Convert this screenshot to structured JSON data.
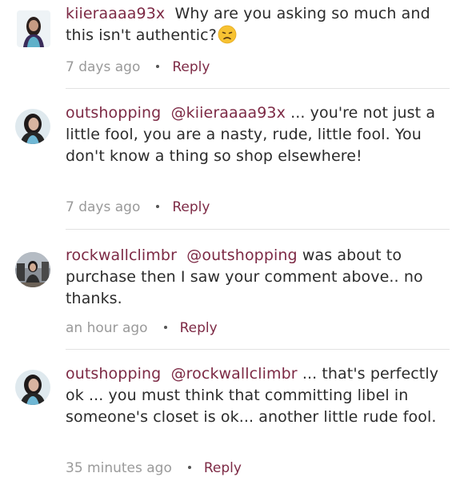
{
  "comments": [
    {
      "username": "kiieraaaa93x",
      "mention": "",
      "text": "Why are you asking so much and this isn't authentic?",
      "emoji": "disappointed-face-emoji",
      "time": "7 days ago",
      "reply_label": "Reply"
    },
    {
      "username": "outshopping",
      "mention": "@kiieraaaa93x",
      "text": "... you're not just a little fool, you are a nasty, rude, little fool. You don't know a thing so shop elsewhere!",
      "time": "7 days ago",
      "reply_label": "Reply"
    },
    {
      "username": "rockwallclimbr",
      "mention": "@outshopping",
      "text": "was about to purchase then I saw your comment above.. no thanks.",
      "time": "an hour ago",
      "reply_label": "Reply"
    },
    {
      "username": "outshopping",
      "mention": "@rockwallclimbr",
      "text": "...  that's perfectly ok ... you must think that committing libel in someone's closet is ok... another little rude fool.",
      "time": "35 minutes ago",
      "reply_label": "Reply"
    }
  ],
  "colors": {
    "link": "#7d2a45",
    "text": "#2b2b2b",
    "meta": "#9a9a9a",
    "divider": "#e2e2e2"
  }
}
